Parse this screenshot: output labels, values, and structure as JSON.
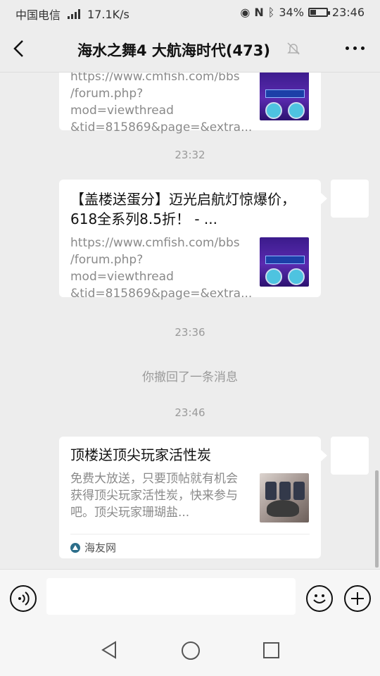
{
  "status_bar": {
    "carrier": "中国电信",
    "network": "4G",
    "speed": "17.1K/s",
    "battery": "34%",
    "time": "23:46"
  },
  "nav": {
    "title": "海水之舞4 大航海时代(473)",
    "back_icon": "chevron-left-icon",
    "mute_icon": "bell-off-icon",
    "more_icon": "more-dots-icon"
  },
  "messages": [
    {
      "type": "link-card",
      "desc": "https://www.cmfish.com/bbs\n/forum.php?mod=viewthread\n&tid=815869&page=&extra..."
    },
    {
      "type": "time",
      "text": "23:32"
    },
    {
      "type": "link-card",
      "title": "【盖楼送蛋分】迈光启航灯惊爆价，618全系列8.5折！ - ...",
      "desc": "https://www.cmfish.com/bbs\n/forum.php?mod=viewthread\n&tid=815869&page=&extra..."
    },
    {
      "type": "time",
      "text": "23:36"
    },
    {
      "type": "system",
      "text": "你撤回了一条消息"
    },
    {
      "type": "time",
      "text": "23:46"
    },
    {
      "type": "link-card",
      "title": "顶楼送顶尖玩家活性炭",
      "desc": "免费大放送，只要顶帖就有机会获得顶尖玩家活性炭，快来参与吧。顶尖玩家珊瑚盐...",
      "source": "海友网"
    }
  ],
  "input_bar": {
    "placeholder": "",
    "icons": [
      "voice-icon",
      "emoji-icon",
      "plus-icon"
    ]
  },
  "android_nav": [
    "back-triangle-icon",
    "home-circle-icon",
    "recent-square-icon"
  ]
}
